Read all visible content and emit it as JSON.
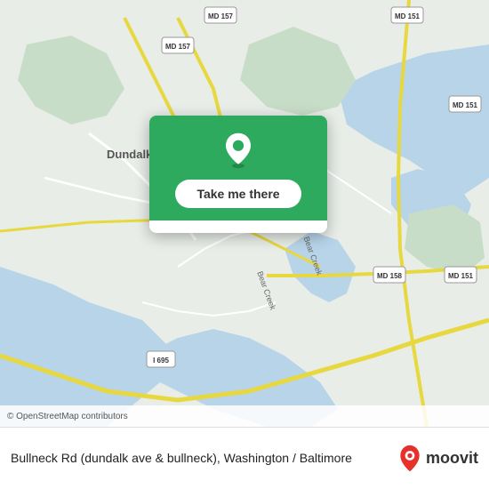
{
  "map": {
    "attribution": "© OpenStreetMap contributors",
    "background_color": "#e8f0e8"
  },
  "popup": {
    "take_me_there_label": "Take me there"
  },
  "info_bar": {
    "location_name": "Bullneck Rd (dundalk ave & bullneck), Washington / Baltimore"
  },
  "moovit": {
    "logo_text": "moovit"
  }
}
